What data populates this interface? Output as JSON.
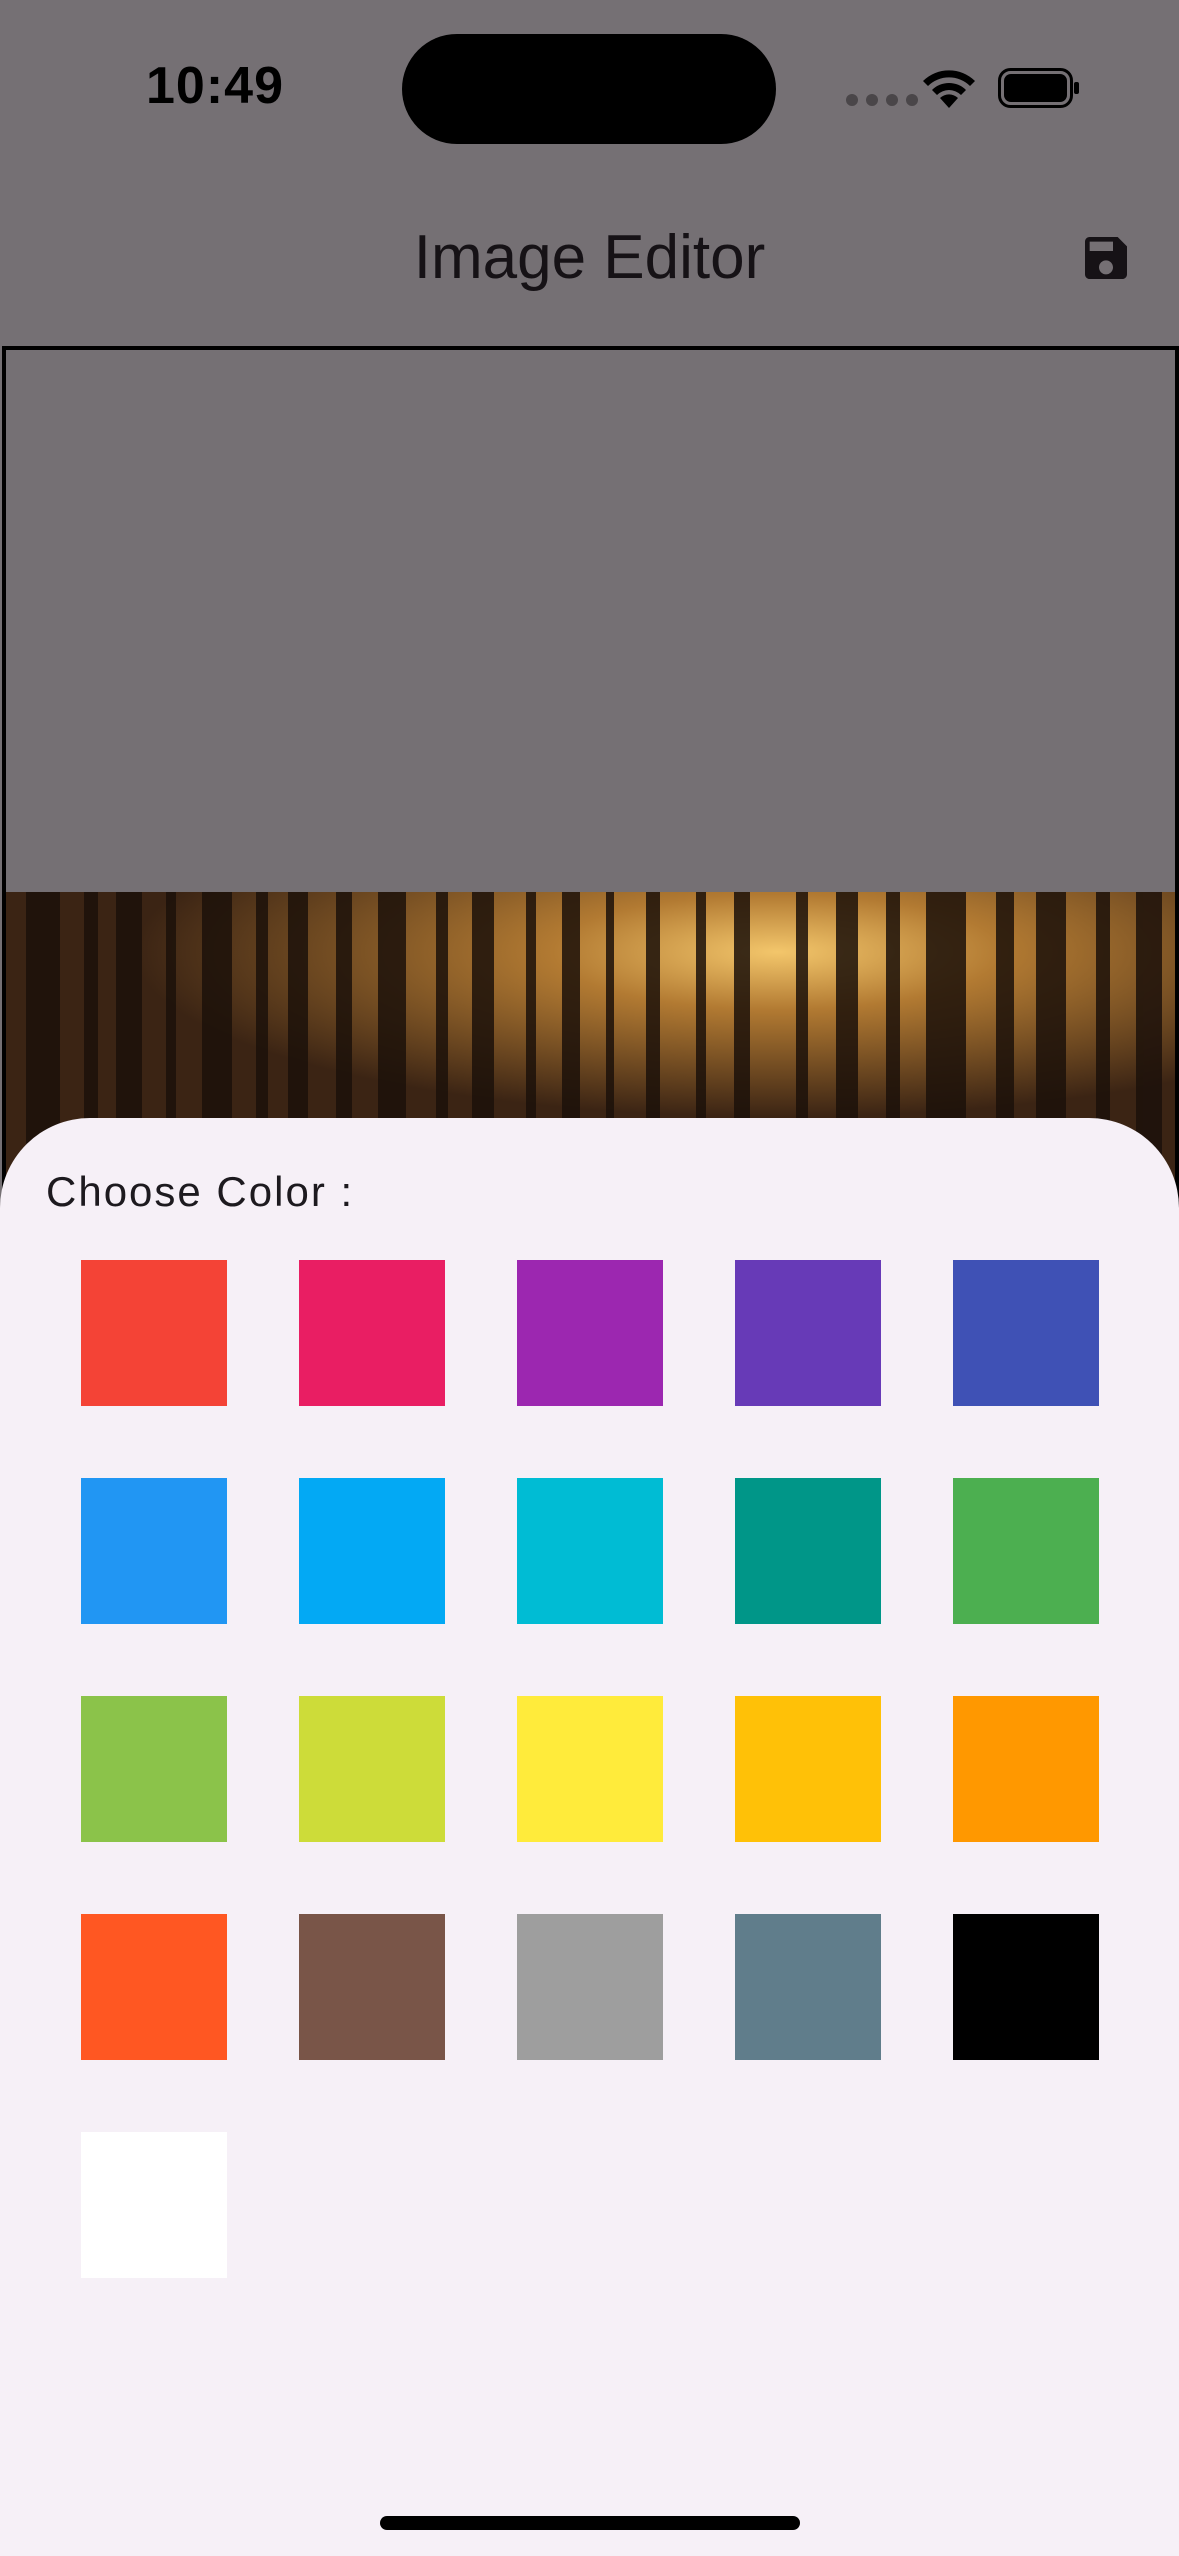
{
  "status_bar": {
    "time": "10:49"
  },
  "app_bar": {
    "title": "Image Editor",
    "save_icon": "save-icon"
  },
  "color_sheet": {
    "title": "Choose Color :",
    "colors": [
      "#f44336",
      "#e91e63",
      "#9c27b0",
      "#673ab7",
      "#3f51b5",
      "#2196f3",
      "#03a9f4",
      "#00bcd4",
      "#009688",
      "#4caf50",
      "#8bc34a",
      "#cddc39",
      "#ffeb3b",
      "#ffc107",
      "#ff9800",
      "#ff5722",
      "#795548",
      "#9e9e9e",
      "#607d8b",
      "#000000",
      "#ffffff"
    ]
  }
}
